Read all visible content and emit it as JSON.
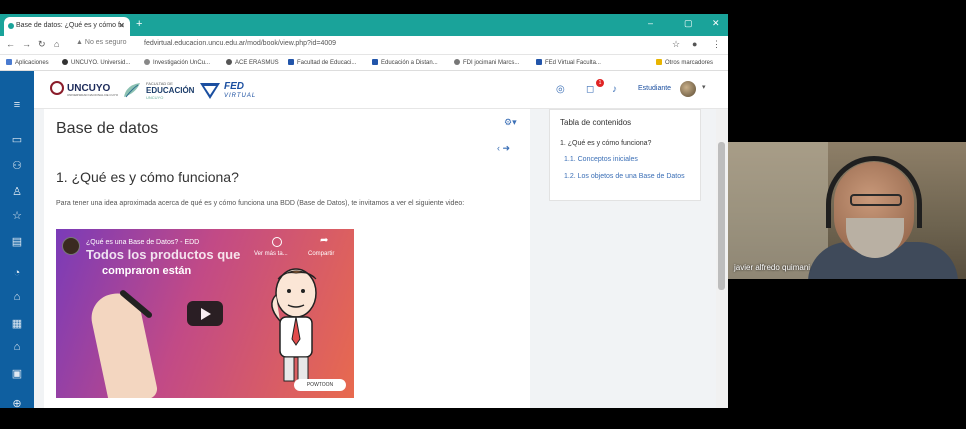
{
  "browser": {
    "tab_title": "Base de datos: ¿Qué es y cómo fu",
    "tab_close": "✕",
    "new_tab": "+",
    "win_min": "–",
    "win_max": "▢",
    "win_close": "✕",
    "security_label": "No es seguro",
    "url": "fedvirtual.educacion.uncu.edu.ar/mod/book/view.php?id=4009",
    "bookmarks": [
      "Aplicaciones",
      "UNCUYO. Universid...",
      "Investigación UnCu...",
      "ACE ERASMUS",
      "Facultad de Educaci...",
      "Educación a Distan...",
      "FDI jocimani Marcs...",
      "FEd Virtual Facultа...",
      "Otros marcadores"
    ]
  },
  "header": {
    "logo_uncuyo": "UNCUYO",
    "logo_uncuyo_sub": "UNIVERSIDAD NACIONAL DE CUYO",
    "logo_fac_1": "FACULTAD DE",
    "logo_fac_2": "EDUCACIÓN",
    "logo_fac_3": "UNCUYO",
    "logo_fed_1": "FED",
    "logo_fed_2": "VIRTUAL",
    "notification_count": "1",
    "user_name": "Estudiante"
  },
  "main": {
    "book_title": "Base de datos",
    "chapter_title": "1. ¿Qué es y cómo funciona?",
    "intro": "Para tener una idea aproximada acerca de qué es y cómo funciona una BDD (Base de Datos), te invitamos a ver el siguiente video:",
    "video": {
      "title": "¿Qué es una Base de Datos? - EDD",
      "overlay_line1": "Todos los productos que",
      "overlay_line2": "compraron están",
      "watch_later": "Ver más ta...",
      "share": "Compartir",
      "brand": "POWTOON"
    }
  },
  "toc": {
    "heading": "Tabla de contenidos",
    "items": [
      "1. ¿Qué es y cómo funciona?",
      "1.1. Conceptos iniciales",
      "1.2. Los objetos de una Base de Datos"
    ]
  },
  "webcam": {
    "participant_name": "javier alfredo quimani"
  },
  "colors": {
    "tabbar": "#1aa39a",
    "sidebar": "#0f5fa0",
    "link": "#3b6fb6"
  }
}
